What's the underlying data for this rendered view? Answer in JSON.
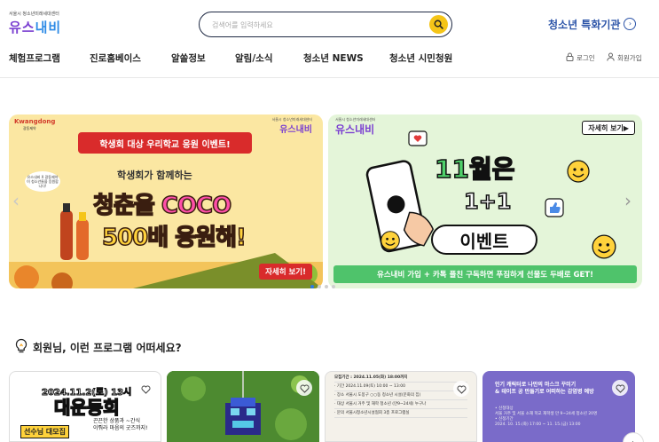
{
  "header": {
    "logo_small": "서울시 청소년미래세대센터",
    "logo_main_1": "유스",
    "logo_main_2": "내비",
    "search_placeholder": "검색어를 입력하세요",
    "special_link": "청소년 특화기관"
  },
  "nav": {
    "items": [
      "체험프로그램",
      "진로홈베이스",
      "알쏠정보",
      "알림/소식",
      "청소년 NEWS",
      "청소년 시민청원"
    ],
    "login": "로그인",
    "signup": "회원가입"
  },
  "banners": {
    "left": {
      "brand": "Kwangdong",
      "brand_sub": "광동제약",
      "logo_sub": "서울시 청소년미래세대센터",
      "logo": "유스내비",
      "headline_tag": "학생회 대상 우리학교 응원 이벤트!",
      "subhead": "학생회가 함께하는",
      "main_1a": "청춘을 ",
      "main_1b": "COCO",
      "main_2": "500배 응원해!",
      "note": "유스내비 X 광동제약이 청소년들을 응원합니다!",
      "button": "자세히 보기!"
    },
    "right": {
      "logo_sub": "서울시 청소년미래세대센터",
      "logo": "유스내비",
      "more_button": "자세히 보기▶",
      "title_1": "11월은",
      "title_2": "1+1",
      "title_3": "이벤트",
      "bottom_text": "유스내비 가입 + 카톡 플친 구독하면 푸짐하게 선물도 두배로 GET!"
    },
    "prev_arrow": "‹",
    "next_arrow": "›",
    "slide_count": 4,
    "active_slide": 1
  },
  "recommend": {
    "title": "회원님, 이런 프로그램 어떠세요?",
    "cards": [
      {
        "text_1": "2024.11.2(토) 13시",
        "text_2": "대운동회",
        "badge": "선수님 대모집",
        "side_1": "끈끈한 상품과 ~간식",
        "side_2": "이뤄라 마음의 굿즈까지!"
      },
      {},
      {
        "lines": [
          "모집기간 : 2024.11.05(화) 18:00까지",
          "· 기간  2024.11.09(토) 10:00 ~ 13:00",
          "· 장소  서울시 도봉구 ○○동 청소년 시설(문화의 집)",
          "· 대상  서울시 거주 및 재학 청소년 (만9~24세) 누구나",
          "· 문의  서울시청소년시설협회 3층 프로그램실"
        ]
      },
      {
        "title_1": "인기 캐릭터로 나만의 마스크 꾸미기",
        "title_2": "& 테이프 공 만들기로 어떠하는 감염병 예방",
        "info_1": "• 신청대상",
        "info_2": "서울 거주 및 서울 소재 학교 재학생 만 9~24세 청소년 20명",
        "info_3": "• 신청기간",
        "info_4": "2024. 10. 15.(화) 17:00 ~ 11. 15.(금) 13:00"
      }
    ],
    "next_arrow": "›"
  },
  "colors": {
    "brand_purple": "#7a3fd1",
    "brand_blue": "#2c54a8",
    "search_button": "#f5c518",
    "dot_active": "#2c7be5"
  }
}
